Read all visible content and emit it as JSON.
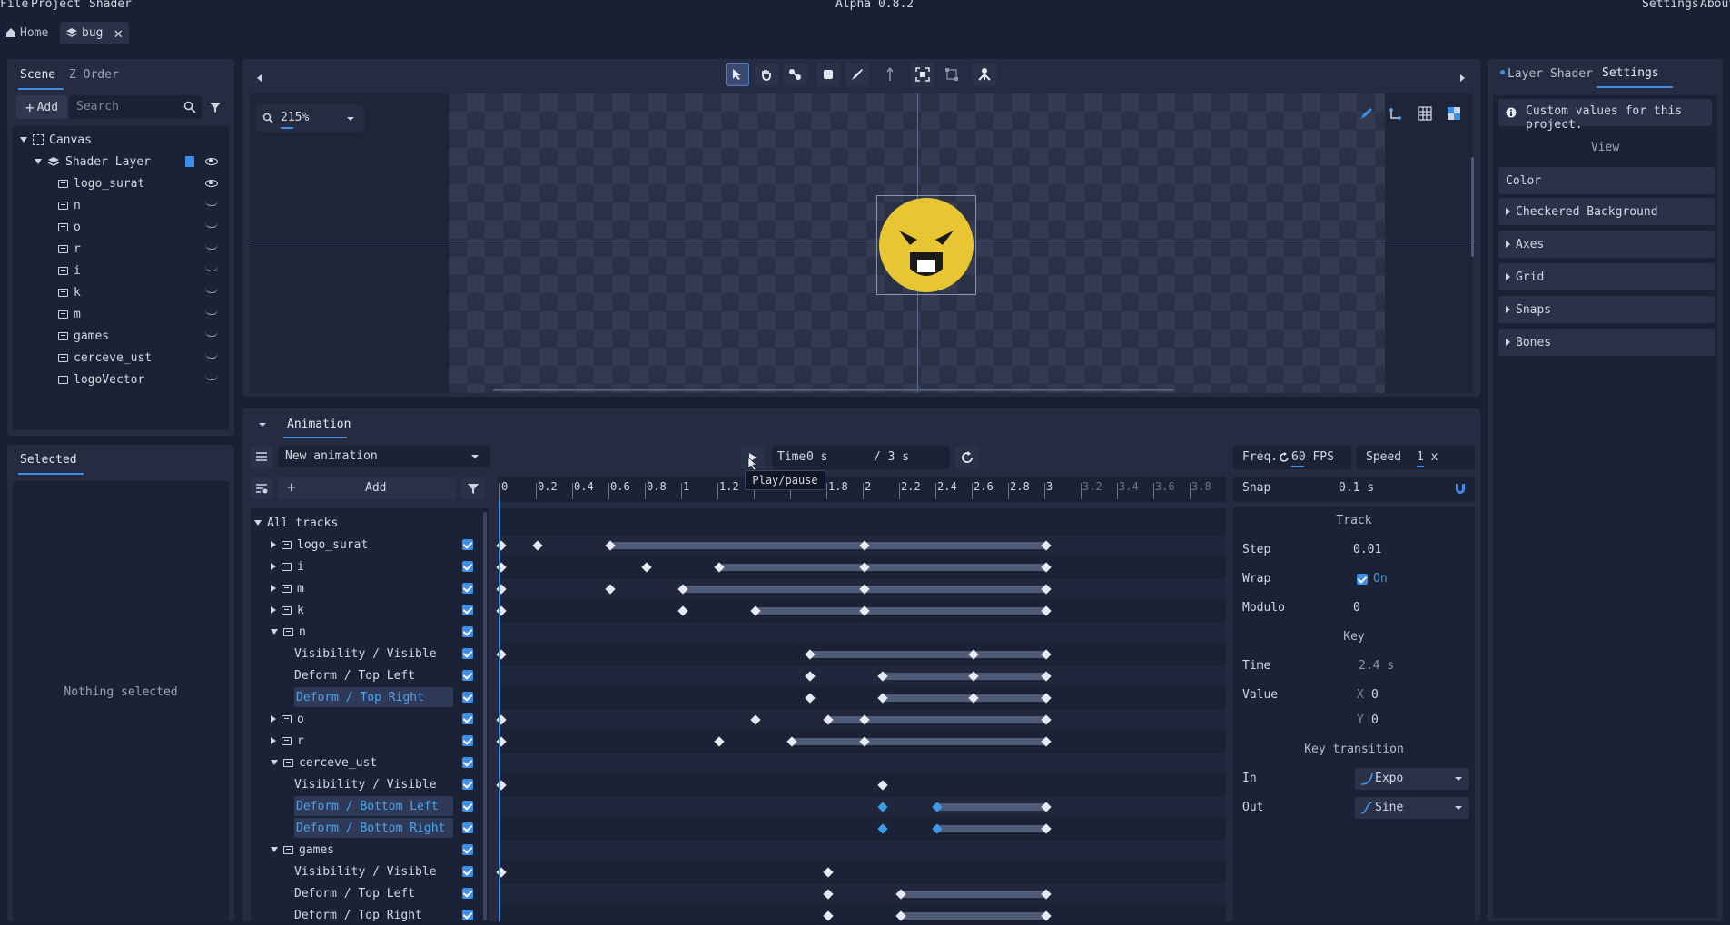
{
  "menu": {
    "file": "File",
    "project": "Project",
    "shader": "Shader",
    "title": "Alpha 0.8.2",
    "settings": "Settings",
    "about": "About"
  },
  "tabs": [
    {
      "label": "Home"
    },
    {
      "label": "bug"
    }
  ],
  "scene_panel": {
    "tab_scene": "Scene",
    "tab_zorder": "Z Order",
    "add_label": "Add",
    "search_placeholder": "Search",
    "tree": [
      {
        "label": "Canvas"
      },
      {
        "label": "Shader Layer"
      },
      {
        "label": "logo_surat"
      },
      {
        "label": "n"
      },
      {
        "label": "o"
      },
      {
        "label": "r"
      },
      {
        "label": "i"
      },
      {
        "label": "k"
      },
      {
        "label": "m"
      },
      {
        "label": "games"
      },
      {
        "label": "cerceve_ust"
      },
      {
        "label": "logoVector"
      }
    ]
  },
  "selected_panel": {
    "title": "Selected",
    "empty": "Nothing selected"
  },
  "viewport": {
    "zoom": "215%"
  },
  "right_panel": {
    "tab_layer_shader": "Layer Shader",
    "tab_settings": "Settings",
    "info": "Custom values for this project.",
    "view_title": "View",
    "color": "Color",
    "sections": [
      "Checkered Background",
      "Axes",
      "Grid",
      "Snaps",
      "Bones"
    ]
  },
  "animation": {
    "tab": "Animation",
    "name": "New animation",
    "add_label": "Add",
    "time_label": "Time",
    "time_value": "0 s",
    "duration": "/ 3 s",
    "tooltip": "Play/pause",
    "freq_label": "Freq.",
    "fps": "60 FPS",
    "speed_label": "Speed",
    "speed_value": "1 x",
    "snap_label": "Snap",
    "snap_value": "0.1 s",
    "ruler": [
      "0",
      "0.2",
      "0.4",
      "0.6",
      "0.8",
      "1",
      "1.2",
      "1.4",
      "1.6",
      "1.8",
      "2",
      "2.2",
      "2.4",
      "2.6",
      "2.8",
      "3",
      "3.2",
      "3.4",
      "3.6",
      "3.8"
    ],
    "tracks": [
      {
        "label": "All tracks"
      },
      {
        "label": "logo_surat"
      },
      {
        "label": "i"
      },
      {
        "label": "m"
      },
      {
        "label": "k"
      },
      {
        "label": "n"
      },
      {
        "label": "Visibility / Visible"
      },
      {
        "label": "Deform / Top Left"
      },
      {
        "label": "Deform / Top Right"
      },
      {
        "label": "o"
      },
      {
        "label": "r"
      },
      {
        "label": "cerceve_ust"
      },
      {
        "label": "Visibility / Visible"
      },
      {
        "label": "Deform / Bottom Left"
      },
      {
        "label": "Deform / Bottom Right"
      },
      {
        "label": "games"
      },
      {
        "label": "Visibility / Visible"
      },
      {
        "label": "Deform / Top Left"
      },
      {
        "label": "Deform / Top Right"
      }
    ],
    "track_props": {
      "title": "Track",
      "step_label": "Step",
      "step_value": "0.01",
      "wrap_label": "Wrap",
      "wrap_value": "On",
      "modulo_label": "Modulo",
      "modulo_value": "0",
      "key_title": "Key",
      "time_label": "Time",
      "time_value": "2.4 s",
      "value_label": "Value",
      "x_label": "X",
      "x_value": "0",
      "y_label": "Y",
      "y_value": "0",
      "transition_title": "Key transition",
      "in_label": "In",
      "in_value": "Expo",
      "out_label": "Out",
      "out_value": "Sine"
    }
  },
  "colors": {
    "accent": "#3c8ee6",
    "panel": "#252c42",
    "bg": "#1a2033"
  }
}
